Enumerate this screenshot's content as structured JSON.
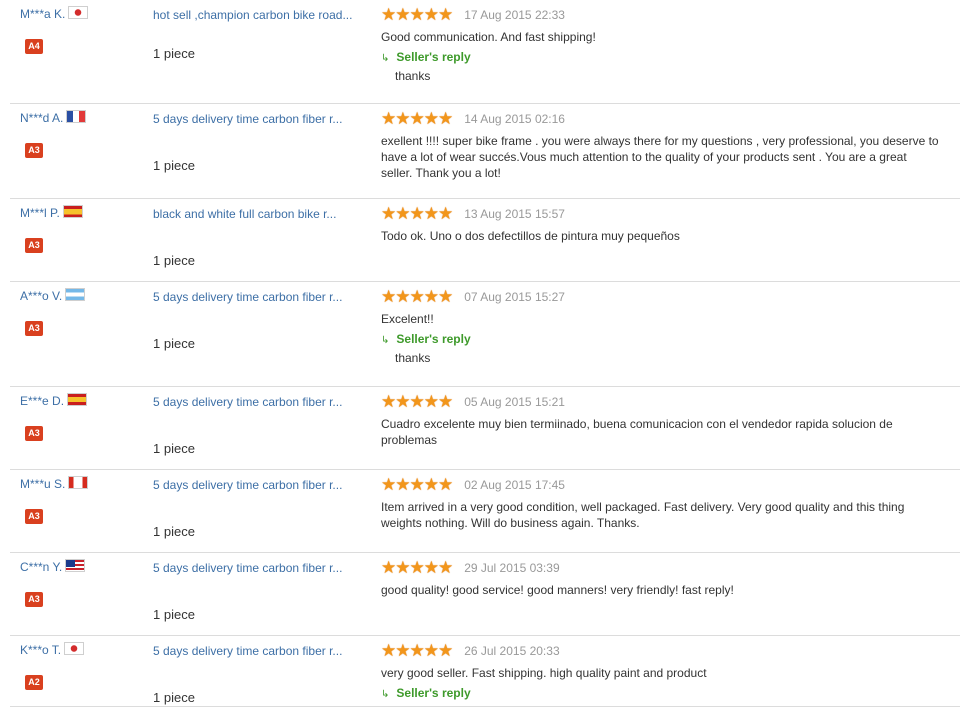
{
  "feedback": [
    {
      "buyer": "M***a K.",
      "flag_icon": "flag-japan",
      "flag_class": "flag-jp",
      "level": "A4",
      "product": "hot sell ,champion carbon bike road...",
      "quantity": "1 piece",
      "stars": "★★★★★",
      "rating": 5,
      "date": "17 Aug 2015 22:33",
      "comment": "Good communication. And fast shipping!",
      "seller_reply_label": "Seller's reply",
      "seller_reply": "thanks"
    },
    {
      "buyer": "N***d A.",
      "flag_icon": "flag-france",
      "flag_class": "flag-fr",
      "level": "A3",
      "product": "5 days delivery time carbon fiber r...",
      "quantity": "1 piece",
      "stars": "★★★★★",
      "rating": 5,
      "date": "14 Aug 2015 02:16",
      "comment": "exellent !!!! super bike frame . you were always there for my questions , very professional, you deserve to have a lot of wear succés.Vous much attention to the quality of your products sent . You are a great seller. Thank you a lot!"
    },
    {
      "buyer": "M***l P.",
      "flag_icon": "flag-spain",
      "flag_class": "flag-es",
      "level": "A3",
      "product": "black and white full carbon bike r...",
      "quantity": "1 piece",
      "stars": "★★★★★",
      "rating": 5,
      "date": "13 Aug 2015 15:57",
      "comment": "Todo ok. Uno o dos defectillos de pintura muy pequeños"
    },
    {
      "buyer": "A***o V.",
      "flag_icon": "flag-argentina",
      "flag_class": "flag-ar",
      "level": "A3",
      "product": "5 days delivery time carbon fiber r...",
      "quantity": "1 piece",
      "stars": "★★★★★",
      "rating": 5,
      "date": "07 Aug 2015 15:27",
      "comment": "Excelent!!",
      "seller_reply_label": "Seller's reply",
      "seller_reply": "thanks"
    },
    {
      "buyer": "E***e D.",
      "flag_icon": "flag-spain",
      "flag_class": "flag-es",
      "level": "A3",
      "product": "5 days delivery time carbon fiber r...",
      "quantity": "1 piece",
      "stars": "★★★★★",
      "rating": 5,
      "date": "05 Aug 2015 15:21",
      "comment": "Cuadro excelente muy bien termiinado, buena comunicacion con el vendedor rapida solucion de problemas"
    },
    {
      "buyer": "M***u S.",
      "flag_icon": "flag-canada",
      "flag_class": "flag-ca",
      "level": "A3",
      "product": "5 days delivery time carbon fiber r...",
      "quantity": "1 piece",
      "stars": "★★★★★",
      "rating": 5,
      "date": "02 Aug 2015 17:45",
      "comment": "Item arrived in a very good condition, well packaged. Fast delivery. Very good quality and this thing weights nothing. Will do business again. Thanks."
    },
    {
      "buyer": "C***n Y.",
      "flag_icon": "flag-malaysia",
      "flag_class": "flag-my",
      "level": "A3",
      "product": "5 days delivery time carbon fiber r...",
      "quantity": "1 piece",
      "stars": "★★★★★",
      "rating": 5,
      "date": "29 Jul 2015 03:39",
      "comment": "good quality! good service! good manners! very friendly! fast reply!"
    },
    {
      "buyer": "K***o T.",
      "flag_icon": "flag-japan",
      "flag_class": "flag-jp",
      "level": "A2",
      "product": "5 days delivery time carbon fiber r...",
      "quantity": "1 piece",
      "stars": "★★★★★",
      "rating": 5,
      "date": "26 Jul 2015 20:33",
      "comment": "very good seller. Fast shipping. high quality paint and product",
      "seller_reply_label": "Seller's reply"
    }
  ]
}
